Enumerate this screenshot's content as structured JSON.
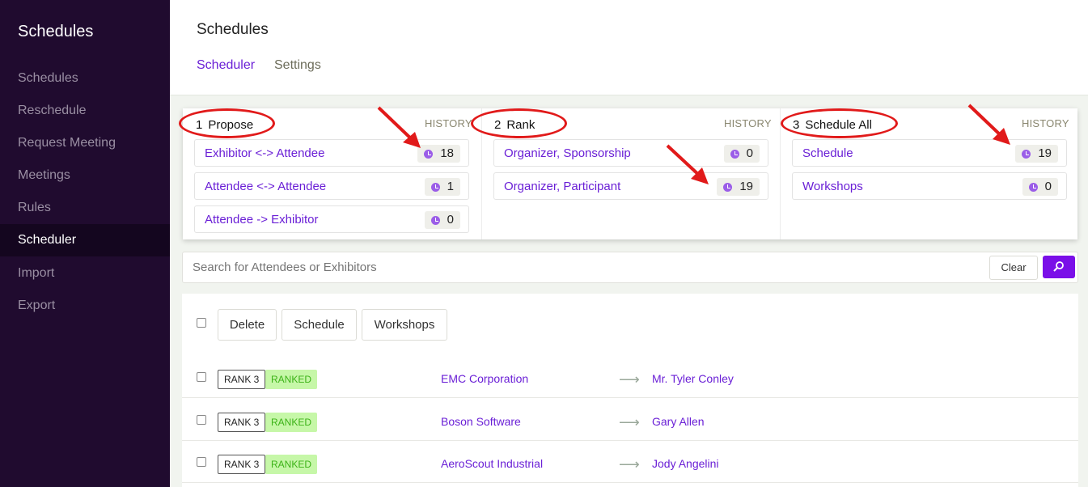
{
  "sidebar": {
    "title": "Schedules",
    "items": [
      {
        "label": "Schedules"
      },
      {
        "label": "Reschedule"
      },
      {
        "label": "Request Meeting"
      },
      {
        "label": "Meetings"
      },
      {
        "label": "Rules"
      },
      {
        "label": "Scheduler"
      },
      {
        "label": "Import"
      },
      {
        "label": "Export"
      }
    ],
    "active": "Scheduler"
  },
  "header": {
    "title": "Schedules",
    "tabs": [
      {
        "label": "Scheduler",
        "active": true
      },
      {
        "label": "Settings",
        "active": false
      }
    ]
  },
  "stages": [
    {
      "number": "1",
      "name": "Propose",
      "history_label": "HISTORY",
      "rows": [
        {
          "label": "Exhibitor <-> Attendee",
          "count": "18"
        },
        {
          "label": "Attendee <-> Attendee",
          "count": "1"
        },
        {
          "label": "Attendee -> Exhibitor",
          "count": "0"
        }
      ]
    },
    {
      "number": "2",
      "name": "Rank",
      "history_label": "HISTORY",
      "rows": [
        {
          "label": "Organizer, Sponsorship",
          "count": "0"
        },
        {
          "label": "Organizer, Participant",
          "count": "19"
        }
      ]
    },
    {
      "number": "3",
      "name": "Schedule All",
      "history_label": "HISTORY",
      "rows": [
        {
          "label": "Schedule",
          "count": "19"
        },
        {
          "label": "Workshops",
          "count": "0"
        }
      ]
    }
  ],
  "search": {
    "placeholder": "Search for Attendees or Exhibitors",
    "clear_label": "Clear"
  },
  "actions": {
    "delete_label": "Delete",
    "schedule_label": "Schedule",
    "workshops_label": "Workshops"
  },
  "meetings": [
    {
      "rank": "RANK 3",
      "status": "RANKED",
      "exhibitor": "EMC Corporation",
      "arrow": "⟶",
      "attendee": "Mr. Tyler Conley"
    },
    {
      "rank": "RANK 3",
      "status": "RANKED",
      "exhibitor": "Boson Software",
      "arrow": "⟶",
      "attendee": "Gary Allen"
    },
    {
      "rank": "RANK 3",
      "status": "RANKED",
      "exhibitor": "AeroScout Industrial",
      "arrow": "⟶",
      "attendee": "Jody Angelini"
    }
  ],
  "colors": {
    "accent": "#6a1fd6",
    "sidebar_bg": "#200b2f",
    "annotation_red": "#e11a1a",
    "ranked_bg": "#c6f7a8",
    "ranked_text": "#3cb317"
  },
  "icons": {
    "history_count": "clock-icon",
    "search_button": "search-icon",
    "meeting_arrow": "arrow-right-icon"
  }
}
